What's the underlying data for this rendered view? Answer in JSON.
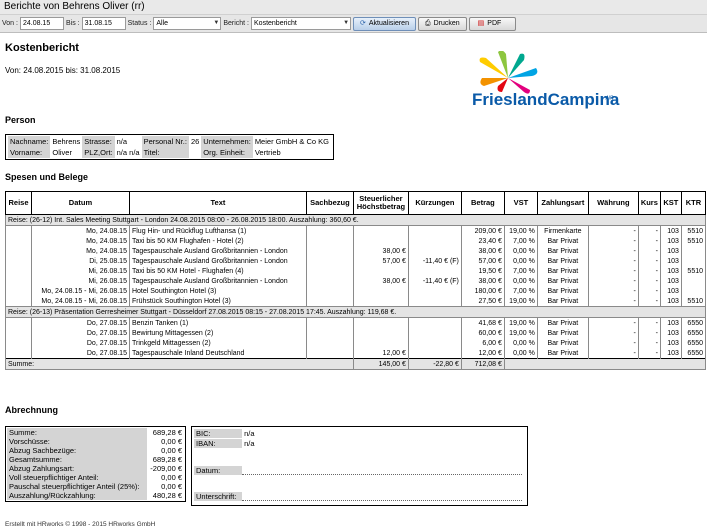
{
  "window": {
    "title": "Berichte von Behrens Oliver (rr)"
  },
  "toolbar": {
    "von_label": "Von :",
    "von_value": "24.08.15",
    "bis_label": "Bis :",
    "bis_value": "31.08.15",
    "status_label": "Status :",
    "status_value": "Alle",
    "bericht_label": "Bericht :",
    "bericht_value": "Kostenbericht",
    "refresh_label": "Aktualisieren",
    "print_label": "Drucken",
    "pdf_label": "PDF"
  },
  "report": {
    "title": "Kostenbericht",
    "period": "Von: 24.08.2015 bis: 31.08.2015",
    "logo_text": "FrieslandCampina"
  },
  "person": {
    "heading": "Person",
    "nachname_label": "Nachname:",
    "nachname": "Behrens",
    "strasse_label": "Strasse:",
    "strasse": "n/a",
    "personal_label": "Personal Nr.:",
    "personal": "26",
    "unternehmen_label": "Unternehmen:",
    "unternehmen": "Meier GmbH & Co KG",
    "vorname_label": "Vorname:",
    "vorname": "Oliver",
    "plz_label": "PLZ,Ort:",
    "plz": "n/a n/a",
    "titel_label": "Titel:",
    "titel": "",
    "einheit_label": "Org. Einheit:",
    "einheit": "Vertrieb"
  },
  "spesen": {
    "heading": "Spesen und Belege",
    "columns": [
      "Reise",
      "Datum",
      "Text",
      "Sachbezug",
      "Steuerlicher Höchstbetrag",
      "Kürzungen",
      "Betrag",
      "VST",
      "Zahlungsart",
      "Währung",
      "Kurs",
      "KST",
      "KTR"
    ],
    "trips": [
      {
        "header": "Reise: (26-12) Int. Sales Meeting Stuttgart - London 24.08.2015 08:00 - 26.08.2015 18:00. Auszahlung: 360,60 €.",
        "rows": [
          [
            "",
            "Mo, 24.08.15",
            "Flug Hin- und Rückflug Lufthansa (1)",
            "",
            "",
            "",
            "209,00 €",
            "19,00 %",
            "Firmenkarte",
            "-",
            "-",
            "103",
            "5510"
          ],
          [
            "",
            "Mo, 24.08.15",
            "Taxi bis 50 KM Flughafen - Hotel (2)",
            "",
            "",
            "",
            "23,40 €",
            "7,00 %",
            "Bar Privat",
            "-",
            "-",
            "103",
            "5510"
          ],
          [
            "",
            "Mo, 24.08.15",
            "Tagespauschale Ausland Großbritannien - London",
            "",
            "38,00 €",
            "",
            "38,00 €",
            "0,00 %",
            "Bar Privat",
            "-",
            "-",
            "103",
            ""
          ],
          [
            "",
            "Di, 25.08.15",
            "Tagespauschale Ausland Großbritannien - London",
            "",
            "57,00 €",
            "-11,40 € (F)",
            "57,00 €",
            "0,00 %",
            "Bar Privat",
            "-",
            "-",
            "103",
            ""
          ],
          [
            "",
            "Mi, 26.08.15",
            "Taxi bis 50 KM Hotel - Flughafen (4)",
            "",
            "",
            "",
            "19,50 €",
            "7,00 %",
            "Bar Privat",
            "-",
            "-",
            "103",
            "5510"
          ],
          [
            "",
            "Mi, 26.08.15",
            "Tagespauschale Ausland Großbritannien - London",
            "",
            "38,00 €",
            "-11,40 € (F)",
            "38,00 €",
            "0,00 %",
            "Bar Privat",
            "-",
            "-",
            "103",
            ""
          ],
          [
            "",
            "Mo, 24.08.15 - Mi, 26.08.15",
            "Hotel Southington Hotel (3)",
            "",
            "",
            "",
            "180,00 €",
            "7,00 %",
            "Bar Privat",
            "-",
            "-",
            "103",
            ""
          ],
          [
            "",
            "Mo, 24.08.15 - Mi, 26.08.15",
            "Frühstück Southington Hotel (3)",
            "",
            "",
            "",
            "27,50 €",
            "19,00 %",
            "Bar Privat",
            "-",
            "-",
            "103",
            "5510"
          ]
        ]
      },
      {
        "header": "Reise: (26-13) Präsentation Gerresheimer Stuttgart - Düsseldorf 27.08.2015 08:15 - 27.08.2015 17:45. Auszahlung: 119,68 €.",
        "rows": [
          [
            "",
            "Do, 27.08.15",
            "Benzin Tanken (1)",
            "",
            "",
            "",
            "41,68 €",
            "19,00 %",
            "Bar Privat",
            "-",
            "-",
            "103",
            "6550"
          ],
          [
            "",
            "Do, 27.08.15",
            "Bewirtung Mittagessen (2)",
            "",
            "",
            "",
            "60,00 €",
            "19,00 %",
            "Bar Privat",
            "-",
            "-",
            "103",
            "6550"
          ],
          [
            "",
            "Do, 27.08.15",
            "Trinkgeld Mittagessen (2)",
            "",
            "",
            "",
            "6,00 €",
            "0,00 %",
            "Bar Privat",
            "-",
            "-",
            "103",
            "6550"
          ],
          [
            "",
            "Do, 27.08.15",
            "Tagespauschale Inland Deutschland",
            "",
            "12,00 €",
            "",
            "12,00 €",
            "0,00 %",
            "Bar Privat",
            "-",
            "-",
            "103",
            "6550"
          ]
        ]
      }
    ],
    "sum_label": "Summe:",
    "sum_hoechst": "145,00 €",
    "sum_kuerz": "-22,80 €",
    "sum_betrag": "712,08 €"
  },
  "abrechnung": {
    "heading": "Abrechnung",
    "rows": [
      [
        "Summe:",
        "689,28 €"
      ],
      [
        "Vorschüsse:",
        "0,00 €"
      ],
      [
        "Abzug Sachbezüge:",
        "0,00 €"
      ],
      [
        "Gesamtsumme:",
        "689,28 €"
      ],
      [
        "Abzug Zahlungsart:",
        "-209,00 €"
      ],
      [
        "Voll steuerpflichtiger Anteil:",
        "0,00 €"
      ],
      [
        "Pauschal steuerpflichtiger Anteil (25%):",
        "0,00 €"
      ],
      [
        "Auszahlung/Rückzahlung:",
        "480,28 €"
      ]
    ],
    "bic_label": "BIC:",
    "bic": "n/a",
    "iban_label": "IBAN:",
    "iban": "n/a",
    "datum_label": "Datum:",
    "unterschrift_label": "Unterschrift:"
  },
  "footer": {
    "text": "Erstellt mit HRworks © 1998 - 2015 HRworks GmbH"
  },
  "colors": {
    "brand_blue": "#0a5aa8",
    "label_bg": "#d4d4d4",
    "row_gray": "#e4e4e4"
  }
}
